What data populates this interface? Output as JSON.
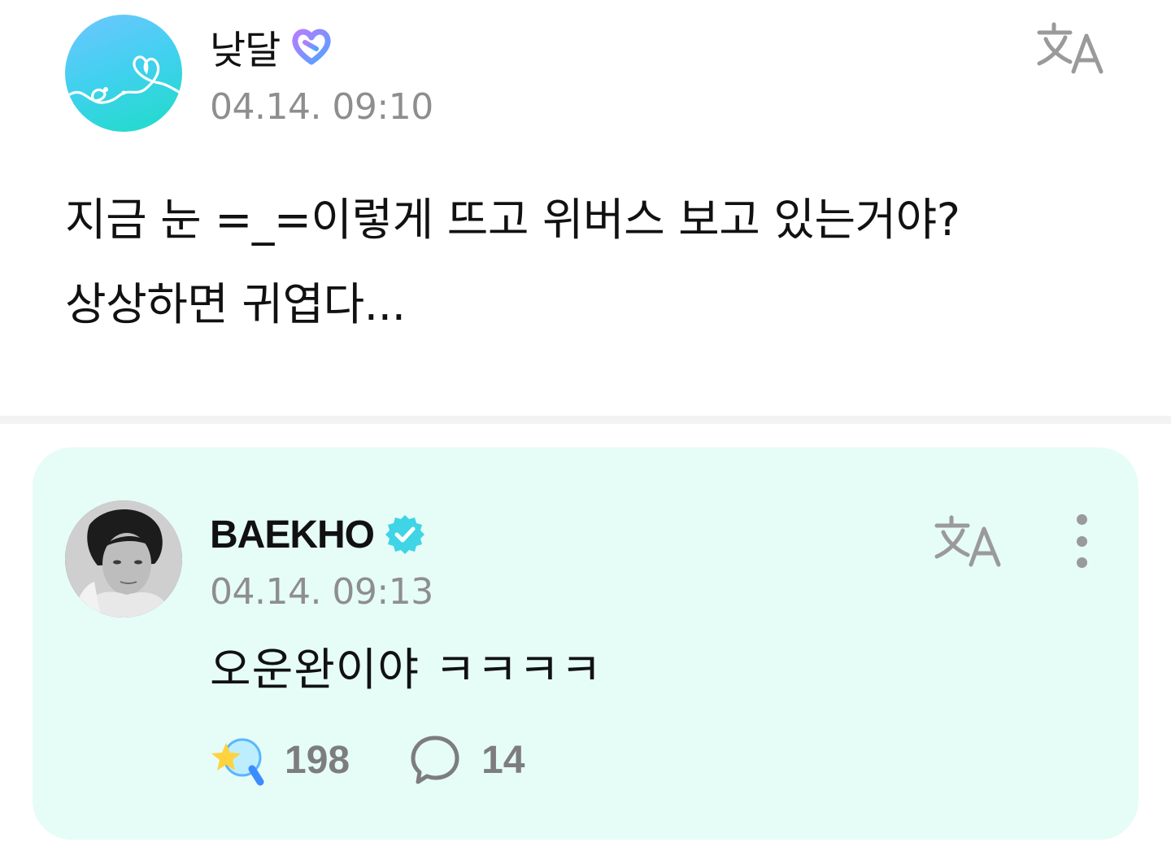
{
  "post": {
    "author": "낮달",
    "timestamp": "04.14. 09:10",
    "body": "지금 눈 =_=이렇게 뜨고 위버스 보고 있는거야?\n상상하면 귀엽다...",
    "fan_badge_icon": "fan-heart-badge-icon",
    "translate_icon": "translate-icon"
  },
  "artist_comment": {
    "author": "BAEKHO",
    "timestamp": "04.14. 09:13",
    "body": "오운완이야 ㅋㅋㅋㅋ",
    "verified_icon": "verified-badge-icon",
    "translate_icon": "translate-icon",
    "more_icon": "more-vertical-icon",
    "reactions": {
      "likes": "198",
      "comments": "14",
      "like_icon": "star-lightstick-icon",
      "comment_icon": "speech-bubble-icon"
    }
  },
  "colors": {
    "card_background": "#e6fcf7",
    "verified_badge": "#3fd4e6",
    "meta_text": "#8e8e8e",
    "divider": "#f3f3f4"
  }
}
